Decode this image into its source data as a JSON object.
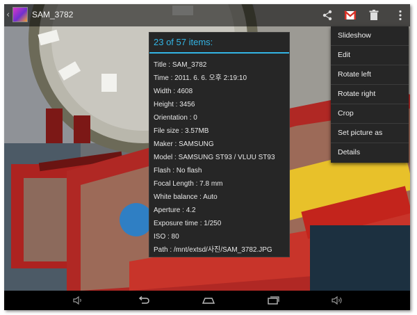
{
  "action_bar": {
    "title": "SAM_3782",
    "icons": [
      "back-chevron-icon",
      "gallery-thumbnail-icon",
      "share-icon",
      "gmail-icon",
      "trash-icon",
      "overflow-menu-icon"
    ]
  },
  "details_dialog": {
    "header": "23 of 57 items:",
    "rows": [
      "Title : SAM_3782",
      "Time : 2011. 6. 6. 오후 2:19:10",
      "Width : 4608",
      "Height : 3456",
      "Orientation : 0",
      "File size : 3.57MB",
      "Maker : SAMSUNG",
      "Model : SAMSUNG ST93 / VLUU ST93",
      "Flash : No flash",
      "Focal Length : 7.8 mm",
      "White balance : Auto",
      "Aperture : 4.2",
      "Exposure time : 1/250",
      "ISO : 80",
      "Path : /mnt/extsd/사진/SAM_3782.JPG"
    ]
  },
  "overflow_menu": {
    "items": [
      "Slideshow",
      "Edit",
      "Rotate left",
      "Rotate right",
      "Crop",
      "Set picture as",
      "Details"
    ]
  },
  "nav_bar": {
    "icons": [
      "volume-down-icon",
      "back-icon",
      "home-icon",
      "recent-apps-icon",
      "volume-up-icon"
    ]
  },
  "colors": {
    "accent": "#33b5e5",
    "dialog_bg": "#262626",
    "menu_bg": "#262626",
    "gmail_red": "#d93025"
  }
}
